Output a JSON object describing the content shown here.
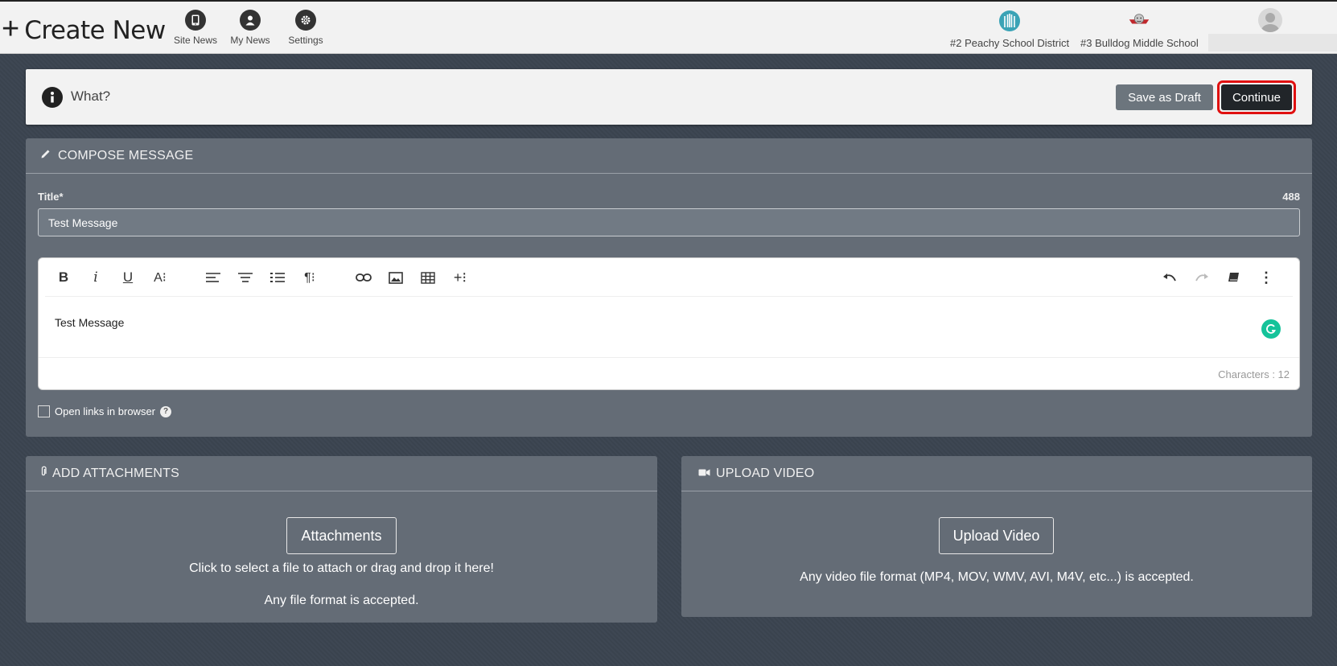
{
  "header": {
    "create_new_label": "Create New",
    "nav": [
      {
        "label": "Site News",
        "icon": "tablet-icon"
      },
      {
        "label": "My News",
        "icon": "user-icon"
      },
      {
        "label": "Settings",
        "icon": "gear-icon"
      }
    ],
    "schools": [
      {
        "label": "#2 Peachy School District",
        "icon": "district-building-logo"
      },
      {
        "label": "#3 Bulldog Middle School",
        "icon": "bulldog-logo"
      }
    ]
  },
  "what_bar": {
    "label": "What?",
    "save_draft_label": "Save as Draft",
    "continue_label": "Continue"
  },
  "compose": {
    "heading": "COMPOSE MESSAGE",
    "title_label": "Title*",
    "title_remaining": "488",
    "title_value": "Test Message",
    "body_text": "Test Message",
    "char_count": "Characters : 12",
    "open_links_label": "Open links in browser",
    "open_links_checked": false,
    "help_glyph": "?"
  },
  "attachments": {
    "heading": "ADD ATTACHMENTS",
    "button_label": "Attachments",
    "hint1": "Click to select a file to attach or drag and drop it here!",
    "hint2": "Any file format is accepted."
  },
  "video": {
    "heading": "UPLOAD VIDEO",
    "button_label": "Upload Video",
    "hint": "Any video file format (MP4, MOV, WMV, AVI, M4V, etc...) is accepted."
  },
  "colors": {
    "highlight_border": "#e01010",
    "panel_bg": "#646c76",
    "page_bg": "#3b4450",
    "grammarly": "#15c39a"
  }
}
